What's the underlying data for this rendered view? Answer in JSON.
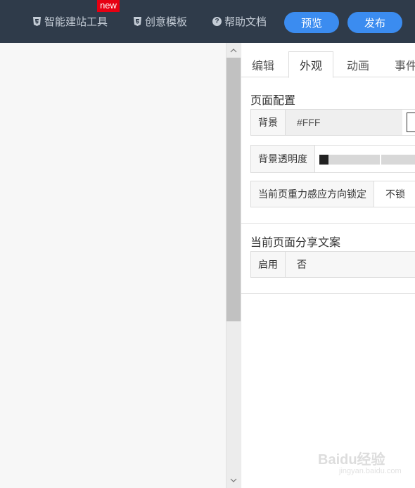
{
  "header": {
    "nav": [
      {
        "label": "智能建站工具",
        "icon": "html5-icon",
        "badge": "new"
      },
      {
        "label": "创意模板",
        "icon": "html5-icon"
      },
      {
        "label": "帮助文档",
        "icon": "help-circle-icon"
      }
    ],
    "preview_label": "预览",
    "publish_label": "发布",
    "colors": {
      "background": "#2f3b4a",
      "button": "#3b8cf0",
      "badge": "#e60012"
    }
  },
  "panel": {
    "tabs": [
      {
        "label": "编辑",
        "active": false
      },
      {
        "label": "外观",
        "active": true
      },
      {
        "label": "动画",
        "active": false
      },
      {
        "label": "事件",
        "active": false
      }
    ],
    "page_config": {
      "title": "页面配置",
      "background": {
        "label": "背景",
        "value": "#FFF"
      },
      "opacity": {
        "label": "背景透明度"
      },
      "gravity": {
        "label": "当前页重力感应方向锁定",
        "value": "不锁"
      }
    },
    "share": {
      "title": "当前页面分享文案",
      "enable": {
        "label": "启用",
        "value": "否"
      }
    }
  },
  "watermark": {
    "text": "Baidu经验",
    "sub": "jingyan.baidu.com"
  }
}
